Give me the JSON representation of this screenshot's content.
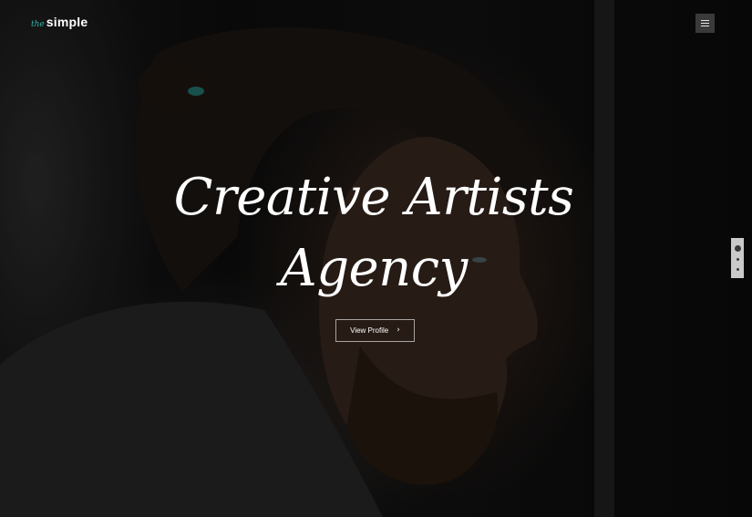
{
  "header": {
    "logo_prefix": "the",
    "logo_name": "simple",
    "menu_icon": "hamburger-icon"
  },
  "hero": {
    "headline_line1": "Creative Artists",
    "headline_line2": "Agency",
    "cta_label": "View Profile",
    "cta_icon": "chevron-right-icon"
  },
  "slider": {
    "total_slides": 3,
    "active_slide": 1
  },
  "colors": {
    "accent": "#2fb4a8",
    "text": "#ffffff",
    "background": "#0b0b0b",
    "menu_button": "#3a3a3a",
    "slider_nav": "#c9c9c9"
  }
}
